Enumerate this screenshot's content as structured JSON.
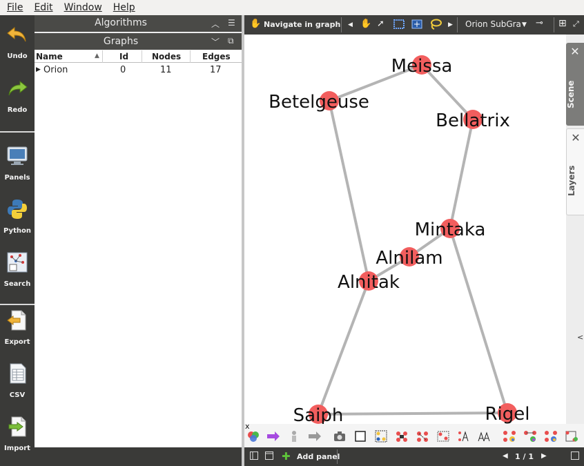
{
  "menubar": {
    "items": [
      "File",
      "Edit",
      "Window",
      "Help"
    ]
  },
  "toolbar": {
    "undo": "Undo",
    "redo": "Redo",
    "panels": "Panels",
    "python": "Python",
    "search": "Search",
    "export": "Export",
    "csv": "CSV",
    "import": "Import"
  },
  "algorithms": {
    "title": "Algorithms"
  },
  "graphs": {
    "title": "Graphs",
    "columns": [
      "Name",
      "Id",
      "Nodes",
      "Edges"
    ],
    "rows": [
      {
        "name": "Orion",
        "id": "0",
        "nodes": "11",
        "edges": "17"
      }
    ]
  },
  "graph_toolbar": {
    "mode": "Navigate in graph",
    "view_select": "Orion SubGra"
  },
  "side_tabs": {
    "scene": "Scene",
    "layers": "Layers"
  },
  "graph": {
    "nodes": [
      {
        "id": "meissa",
        "label": "Meissa"
      },
      {
        "id": "betelgeuse",
        "label": "Betelgeuse"
      },
      {
        "id": "bellatrix",
        "label": "Bellatrix"
      },
      {
        "id": "mintaka",
        "label": "Mintaka"
      },
      {
        "id": "alnilam",
        "label": "Alnilam"
      },
      {
        "id": "alnitak",
        "label": "Alnitak"
      },
      {
        "id": "saiph",
        "label": "Saiph"
      },
      {
        "id": "rigel",
        "label": "Rigel"
      }
    ],
    "edges": [
      [
        "meissa",
        "betelgeuse"
      ],
      [
        "meissa",
        "bellatrix"
      ],
      [
        "betelgeuse",
        "alnitak"
      ],
      [
        "bellatrix",
        "mintaka"
      ],
      [
        "mintaka",
        "alnilam"
      ],
      [
        "alnilam",
        "alnitak"
      ],
      [
        "alnitak",
        "saiph"
      ],
      [
        "mintaka",
        "rigel"
      ],
      [
        "saiph",
        "rigel"
      ]
    ],
    "node_color": "#f25e5e",
    "edge_color": "#b4b4b4"
  },
  "bottom_toolbar": {
    "close_label": "x"
  },
  "status": {
    "add_panel": "Add panel",
    "page": "1 / 1"
  }
}
